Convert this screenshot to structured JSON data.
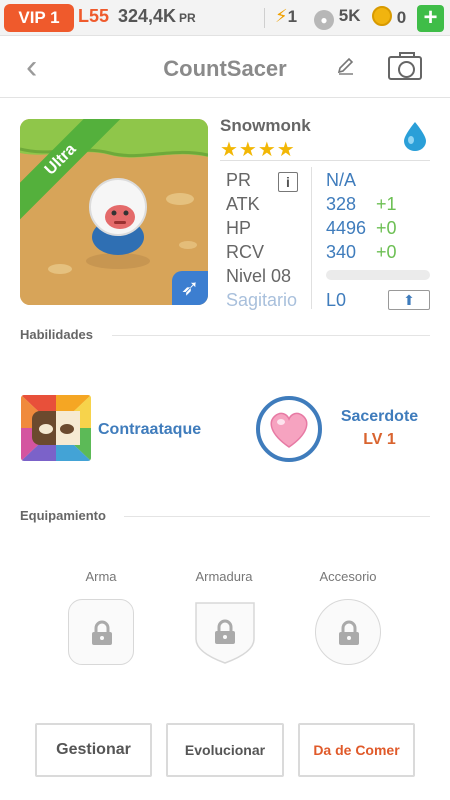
{
  "topbar": {
    "vip": "VIP 1",
    "level": "L55",
    "pr_value": "324,4K",
    "pr_unit": "PR",
    "energy": "1",
    "paw": "5K",
    "coins": "0",
    "plus": "+"
  },
  "header": {
    "back": "‹",
    "title": "CountSacer",
    "edit_icon": "pencil-icon",
    "camera_icon": "camera-icon"
  },
  "pet": {
    "rarity": "Ultra",
    "name": "Snowmonk",
    "stars": "★★★★",
    "element_icon": "water-drop-icon",
    "stats": {
      "pr_label": "PR",
      "pr_info": "i",
      "pr_value": "N/A",
      "atk_label": "ATK",
      "atk_value": "328",
      "atk_bonus": "+1",
      "hp_label": "HP",
      "hp_value": "4496",
      "hp_bonus": "+0",
      "rcv_label": "RCV",
      "rcv_value": "340",
      "rcv_bonus": "+0",
      "level_label": "Nivel 08",
      "level_progress": 0.0
    },
    "sign_name": "Sagitario",
    "sign_level": "L0",
    "upgrade_icon": "up-arrow-icon"
  },
  "colors": {
    "accent_blue": "#3f7cbc",
    "accent_orange": "#ef5a2c",
    "bonus_green": "#6cbf53",
    "ultra_green": "#54b03c"
  },
  "abilities": {
    "title": "Habilidades",
    "skill1_name": "Contraataque",
    "skill2_name": "Sacerdote",
    "skill2_level": "LV 1"
  },
  "equipment": {
    "title": "Equipamiento",
    "slot1": "Arma",
    "slot2": "Armadura",
    "slot3": "Accesorio"
  },
  "actions": {
    "manage": "Gestionar",
    "evolve": "Evolucionar",
    "feed": "Da de Comer"
  }
}
